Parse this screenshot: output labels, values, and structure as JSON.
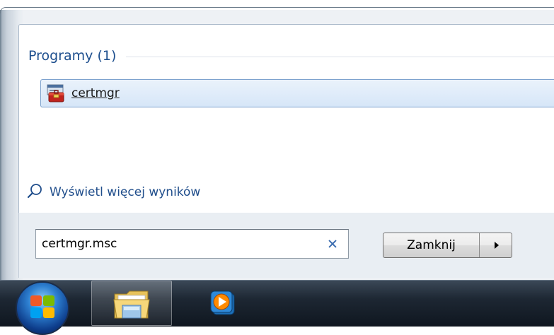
{
  "start_menu": {
    "section_title": "Programy (1)",
    "result": {
      "label": "certmgr",
      "icon": "certificate-manager-icon"
    },
    "more_results_label": "Wyświetl więcej wyników",
    "search": {
      "value": "certmgr.msc",
      "clear_icon": "clear-icon"
    },
    "shutdown": {
      "label": "Zamknij",
      "arrow_icon": "arrow-right-icon"
    }
  },
  "taskbar": {
    "items": [
      {
        "name": "Windows Explorer",
        "icon": "folder-icon",
        "active": true
      },
      {
        "name": "Windows Media Player",
        "icon": "media-player-icon",
        "active": false
      }
    ]
  },
  "colors": {
    "section_title": "#1e4f8e",
    "link": "#1f4d8b",
    "selection_border": "#7da2ce"
  }
}
